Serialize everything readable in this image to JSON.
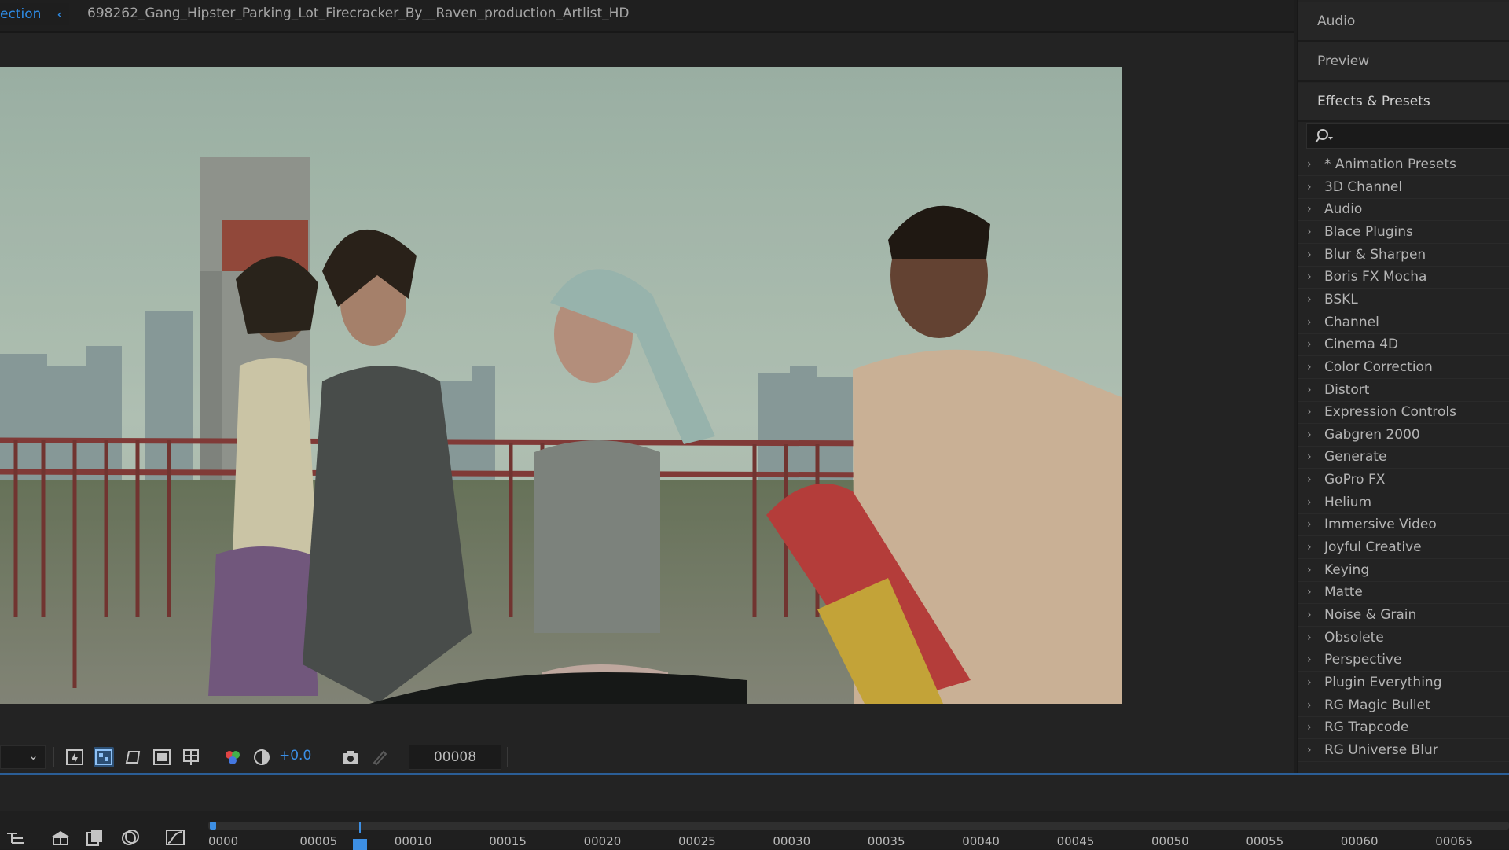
{
  "composition": {
    "tab_label": "ection",
    "title": "698262_Gang_Hipster_Parking_Lot_Firecracker_By__Raven_production_Artlist_HD",
    "viewer_toolbar": {
      "exposure": "+0.0",
      "current_frame": "00008"
    }
  },
  "right_panel": {
    "audio_label": "Audio",
    "preview_label": "Preview",
    "effects_label": "Effects & Presets",
    "effects_items": [
      "* Animation Presets",
      "3D Channel",
      "Audio",
      "Blace Plugins",
      "Blur & Sharpen",
      "Boris FX Mocha",
      "BSKL",
      "Channel",
      "Cinema 4D",
      "Color Correction",
      "Distort",
      "Expression Controls",
      "Gabgren 2000",
      "Generate",
      "GoPro FX",
      "Helium",
      "Immersive Video",
      "Joyful Creative",
      "Keying",
      "Matte",
      "Noise & Grain",
      "Obsolete",
      "Perspective",
      "Plugin Everything",
      "RG Magic Bullet",
      "RG Trapcode",
      "RG Universe Blur"
    ]
  },
  "timeline": {
    "ruler_labels": [
      "0000",
      "00005",
      "00010",
      "00015",
      "00020",
      "00025",
      "00030",
      "00035",
      "00040",
      "00045",
      "00050",
      "00055",
      "00060",
      "00065"
    ],
    "playhead_frame": 8
  },
  "colors": {
    "accent_blue": "#2e8ce6",
    "panel_bg": "#232323"
  }
}
